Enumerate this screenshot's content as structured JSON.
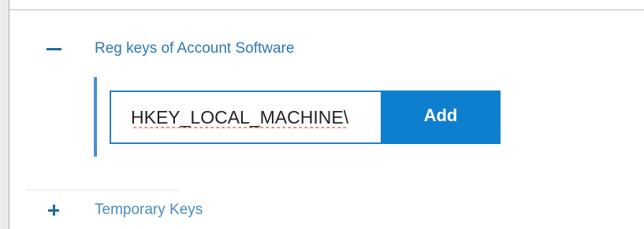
{
  "sections": {
    "reg_keys": {
      "label": "Reg keys of Account Software",
      "state": "expanded",
      "toggle_icon": "minus-icon"
    },
    "temporary_keys": {
      "label": "Temporary Keys",
      "state": "collapsed",
      "toggle_icon": "plus-icon"
    }
  },
  "key_input": {
    "value": "HKEY_LOCAL_MACHINE\\"
  },
  "add_button": {
    "label": "Add"
  },
  "colors": {
    "accent": "#0e7fcf",
    "link_text": "#2e78b0",
    "toggle": "#1f6ca5",
    "input_border": "#2a7fc7",
    "spellcheck_underline": "#d9332a"
  }
}
